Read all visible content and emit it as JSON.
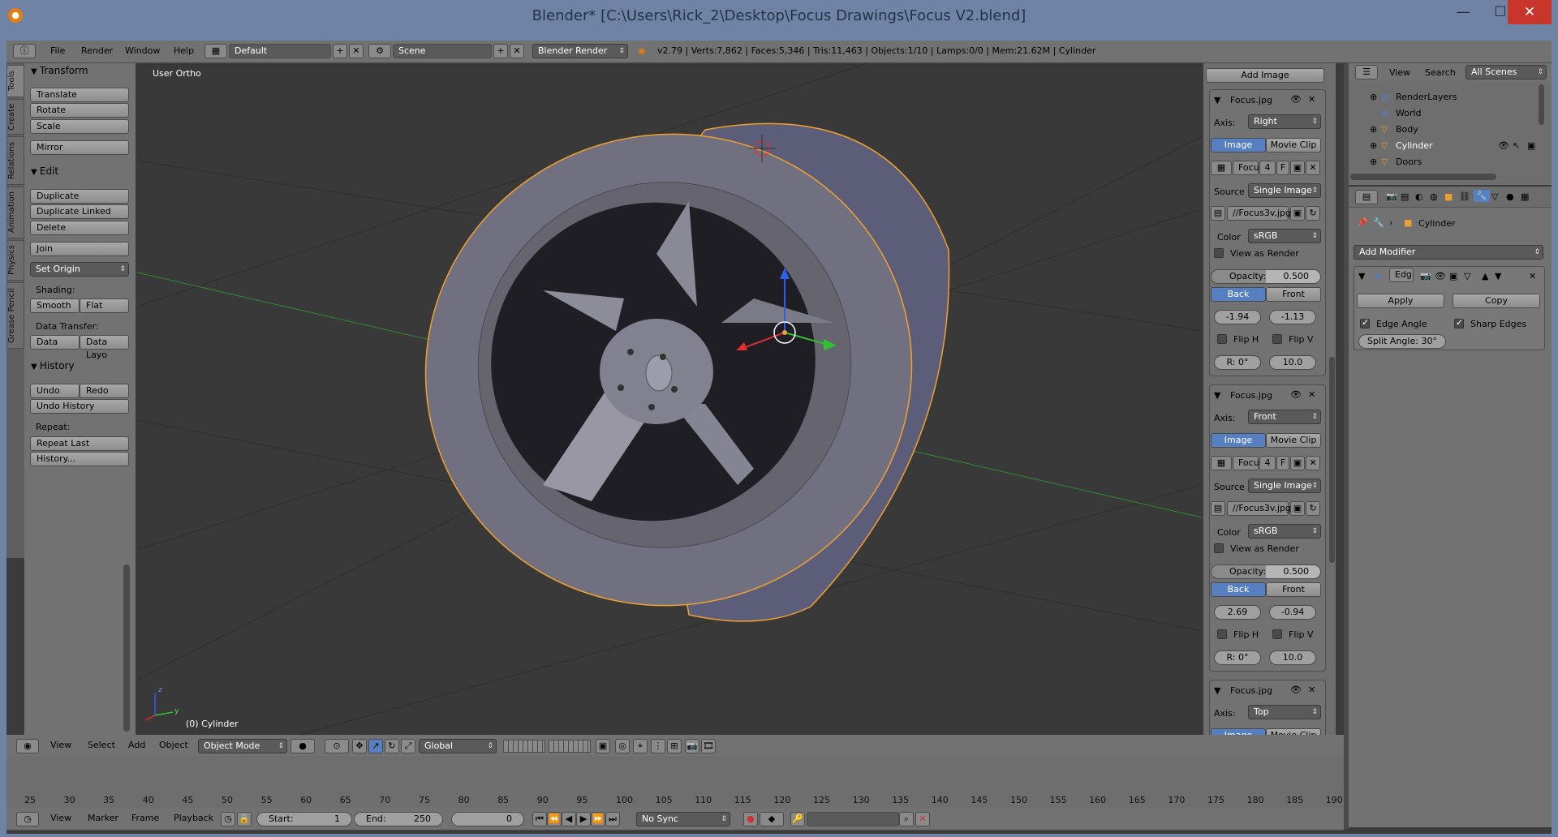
{
  "window": {
    "title": "Blender* [C:\\Users\\Rick_2\\Desktop\\Focus Drawings\\Focus V2.blend]",
    "minimize": "—",
    "maximize": "☐",
    "close": "✕"
  },
  "topbar": {
    "menus": [
      "File",
      "Render",
      "Window",
      "Help"
    ],
    "layout": "Default",
    "scene": "Scene",
    "engine": "Blender Render",
    "stats": "v2.79 | Verts:7,862 | Faces:5,346 | Tris:11,463 | Objects:1/10 | Lamps:0/0 | Mem:21.62M | Cylinder"
  },
  "tool_tabs": [
    "Tools",
    "Create",
    "Relations",
    "Animation",
    "Physics",
    "Grease Pencil"
  ],
  "tools": {
    "transform_title": "Transform",
    "translate": "Translate",
    "rotate": "Rotate",
    "scale": "Scale",
    "mirror": "Mirror",
    "edit_title": "Edit",
    "duplicate": "Duplicate",
    "duplicate_linked": "Duplicate Linked",
    "delete": "Delete",
    "join": "Join",
    "set_origin": "Set Origin",
    "shading_label": "Shading:",
    "smooth": "Smooth",
    "flat": "Flat",
    "data_transfer_label": "Data Transfer:",
    "data": "Data",
    "data_layout": "Data Layo",
    "history_title": "History",
    "undo": "Undo",
    "redo": "Redo",
    "undo_history": "Undo History",
    "repeat_label": "Repeat:",
    "repeat_last": "Repeat Last",
    "history_btn": "History..."
  },
  "viewport": {
    "view_label": "User Ortho",
    "object_label": "(0) Cylinder",
    "axis_x": "x",
    "axis_z": "z",
    "axis_y": "y"
  },
  "bg_images": {
    "add_image": "Add Image",
    "panels": [
      {
        "name": "Focus.jpg",
        "axis": "Right",
        "image_tab": "Image",
        "movie_tab": "Movie Clip",
        "img_name": "Focu",
        "users": "4",
        "fake": "F",
        "source_label": "Source",
        "source": "Single Image",
        "path": "//Focus3v.jpg",
        "color_label": "Color",
        "color": "sRGB",
        "view_render": "View as Render",
        "opacity_label": "Opacity:",
        "opacity": "0.500",
        "opacity_fraction": 0.5,
        "back": "Back",
        "front": "Front",
        "offset_x": "-1.94",
        "offset_y": "-1.13",
        "flip_h": "Flip H",
        "flip_v": "Flip V",
        "rotation": "R: 0°",
        "size": "10.0"
      },
      {
        "name": "Focus.jpg",
        "axis": "Front",
        "image_tab": "Image",
        "movie_tab": "Movie Clip",
        "img_name": "Focu",
        "users": "4",
        "fake": "F",
        "source_label": "Source",
        "source": "Single Image",
        "path": "//Focus3v.jpg",
        "color_label": "Color",
        "color": "sRGB",
        "view_render": "View as Render",
        "opacity_label": "Opacity:",
        "opacity": "0.500",
        "opacity_fraction": 0.5,
        "back": "Back",
        "front": "Front",
        "offset_x": "2.69",
        "offset_y": "-0.94",
        "flip_h": "Flip H",
        "flip_v": "Flip V",
        "rotation": "R: 0°",
        "size": "10.0"
      },
      {
        "name": "Focus.jpg",
        "axis": "Top",
        "image_tab": "Image",
        "movie_tab": "Movie Clip"
      }
    ],
    "axis_label": "Axis:"
  },
  "outliner": {
    "view": "View",
    "search": "Search",
    "filter": "All Scenes",
    "items": [
      {
        "label": "RenderLayers"
      },
      {
        "label": "World"
      },
      {
        "label": "Body"
      },
      {
        "label": "Cylinder"
      },
      {
        "label": "Doors"
      }
    ]
  },
  "properties": {
    "object": "Cylinder",
    "add_modifier": "Add Modifier",
    "modifier_name": "Edg",
    "apply": "Apply",
    "copy": "Copy",
    "edge_angle": "Edge Angle",
    "sharp_edges": "Sharp Edges",
    "split_angle": "Split Angle: 30°"
  },
  "bottom3d": {
    "menus": [
      "View",
      "Select",
      "Add",
      "Object"
    ],
    "mode": "Object Mode",
    "orientation": "Global"
  },
  "timeline": {
    "ticks": [
      "25",
      "30",
      "35",
      "40",
      "45",
      "50",
      "55",
      "60",
      "65",
      "70",
      "75",
      "80",
      "85",
      "90",
      "95",
      "100",
      "105",
      "110",
      "115",
      "120",
      "125",
      "130",
      "135",
      "140",
      "145",
      "150",
      "155",
      "160",
      "165",
      "170",
      "175",
      "180",
      "185",
      "190"
    ],
    "menus": [
      "View",
      "Marker",
      "Frame",
      "Playback"
    ],
    "start_label": "Start:",
    "start": "1",
    "end_label": "End:",
    "end": "250",
    "current": "0",
    "sync": "No Sync"
  },
  "colors": {
    "accent_blue": "#5680c2",
    "selection_orange": "#f0a030",
    "viewport_bg": "#393939"
  }
}
